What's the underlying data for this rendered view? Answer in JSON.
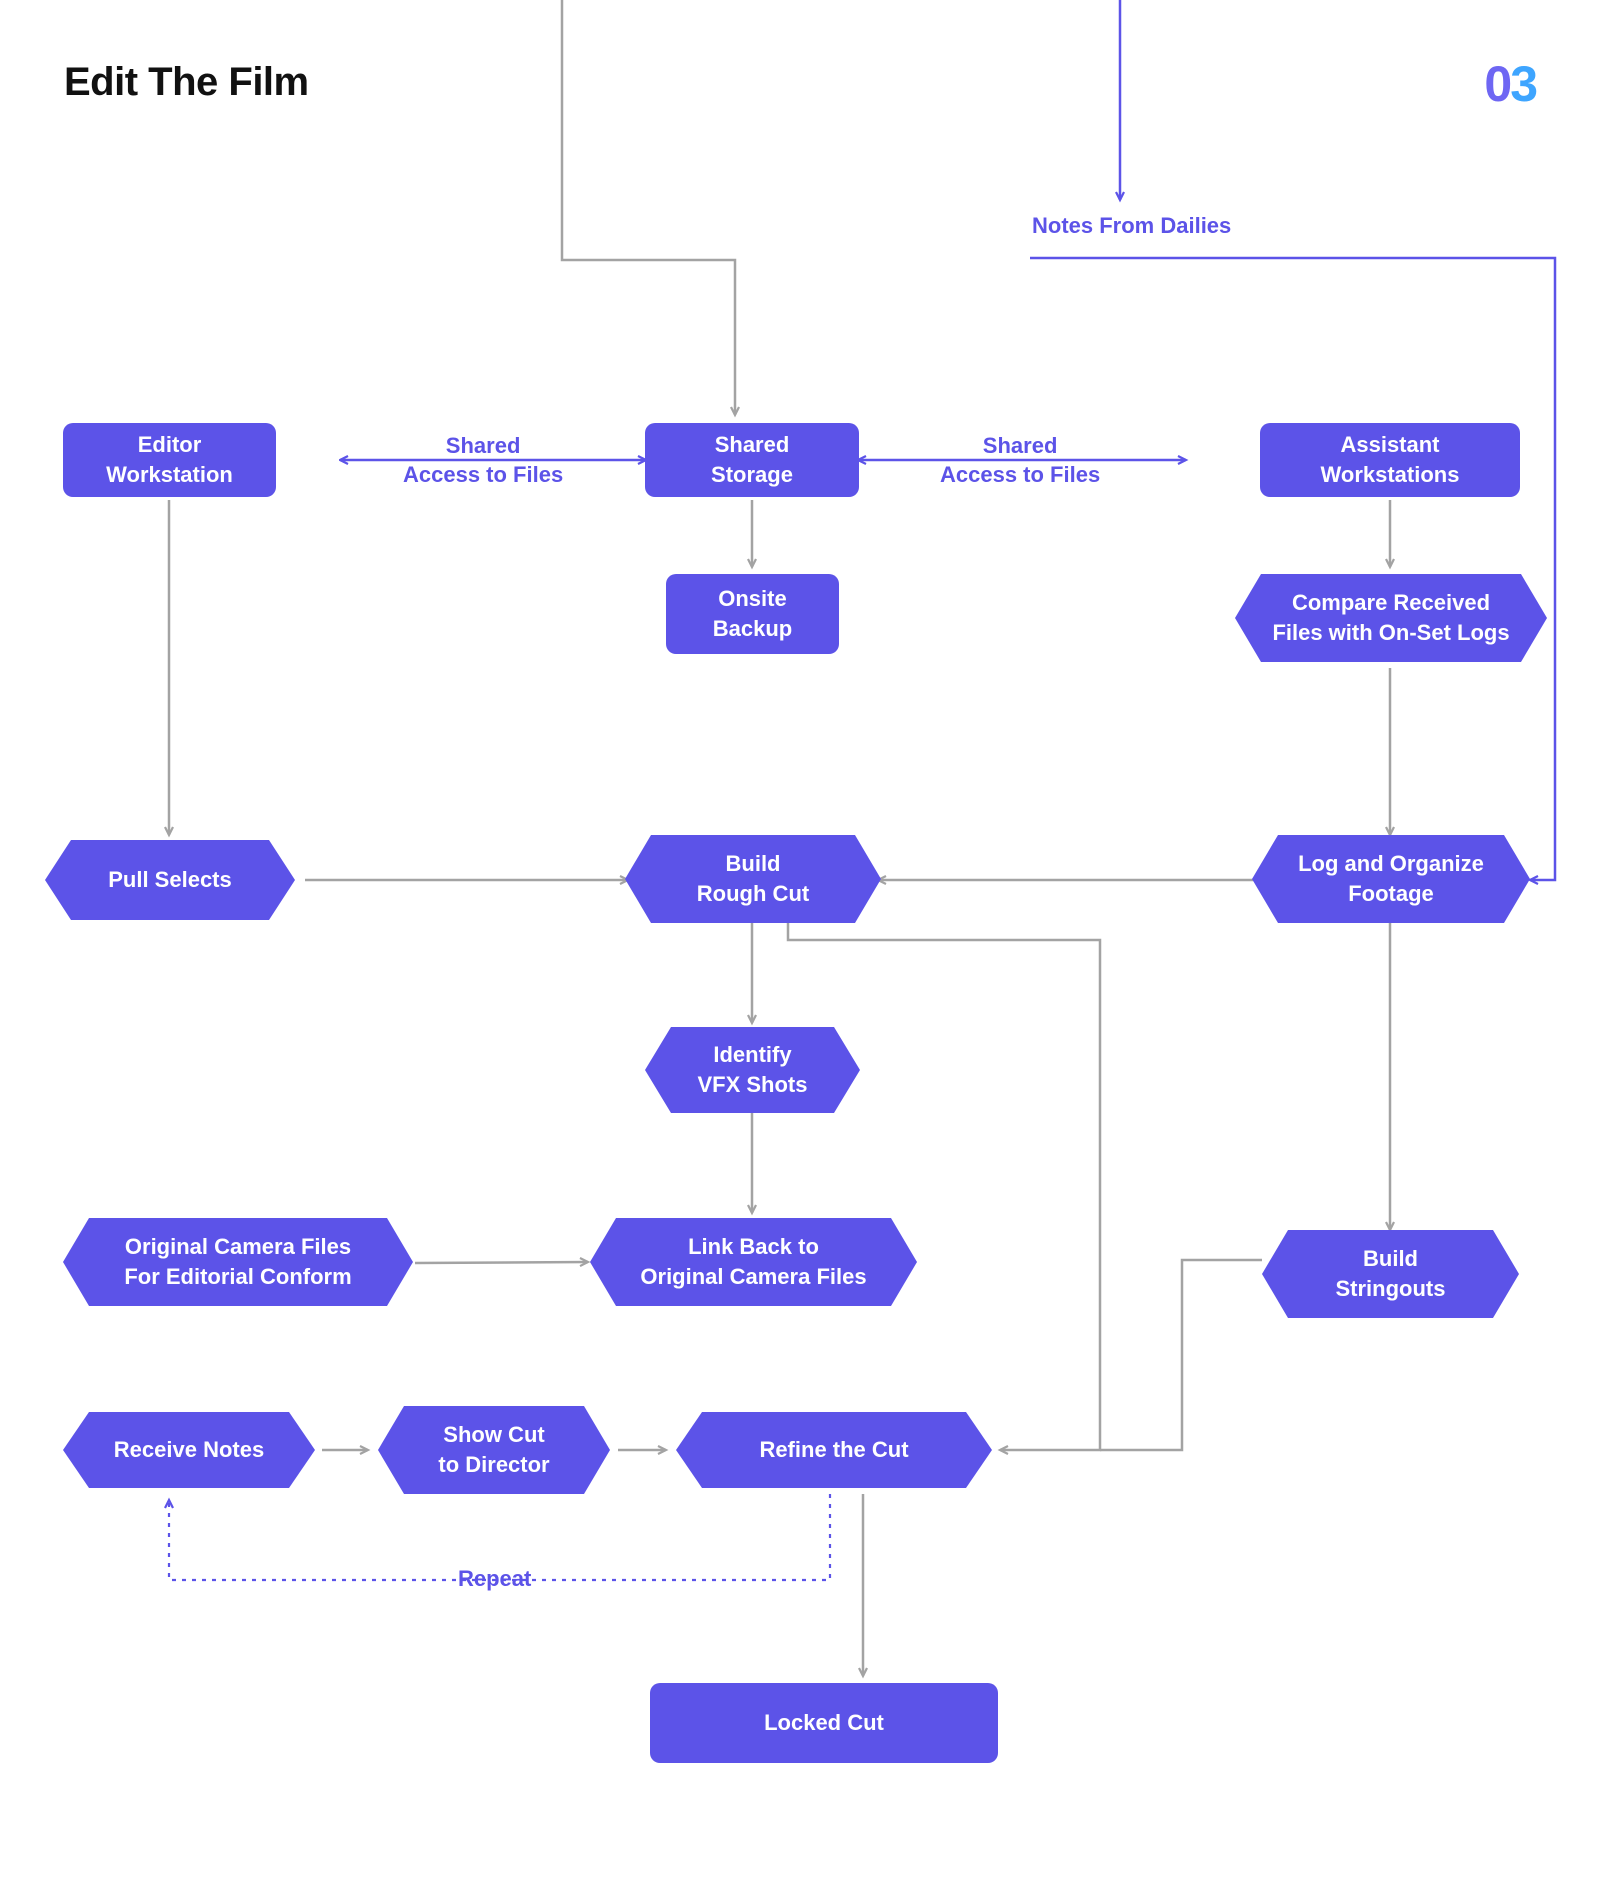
{
  "header": {
    "title": "Edit The Film",
    "chapter": "03"
  },
  "labels": {
    "notes_from_dailies": "Notes From Dailies",
    "shared_left": "Shared\nAccess to Files",
    "shared_right": "Shared\nAccess to Files",
    "repeat": "Repeat"
  },
  "nodes": {
    "editor_workstation": "Editor\nWorkstation",
    "shared_storage": "Shared Storage",
    "assistant_workstations": "Assistant\nWorkstations",
    "onsite_backup": "Onsite\nBackup",
    "compare_logs": "Compare Received\nFiles with On-Set Logs",
    "pull_selects": "Pull Selects",
    "build_rough_cut": "Build\nRough Cut",
    "log_organize": "Log and Organize\nFootage",
    "identify_vfx": "Identify\nVFX Shots",
    "original_camera_files": "Original Camera Files\nFor Editorial Conform",
    "link_back": "Link Back to\nOriginal Camera Files",
    "build_stringouts": "Build\nStringouts",
    "receive_notes": "Receive Notes",
    "show_cut": "Show Cut\nto Director",
    "refine_cut": "Refine the Cut",
    "locked_cut": "Locked Cut"
  }
}
